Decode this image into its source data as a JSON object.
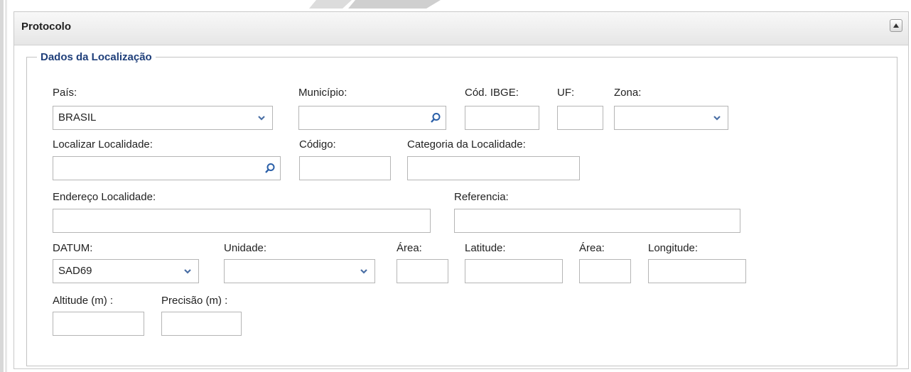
{
  "panel": {
    "title": "Protocolo"
  },
  "fieldset": {
    "legend": "Dados da Localização"
  },
  "labels": {
    "pais": "País:",
    "municipio": "Município:",
    "cod_ibge": "Cód. IBGE:",
    "uf": "UF:",
    "zona": "Zona:",
    "localizar": "Localizar Localidade:",
    "codigo": "Código:",
    "categoria": "Categoria da Localidade:",
    "endereco": "Endereço Localidade:",
    "referencia": "Referencia:",
    "datum": "DATUM:",
    "unidade": "Unidade:",
    "area1": "Área:",
    "latitude": "Latitude:",
    "area2": "Área:",
    "longitude": "Longitude:",
    "altitude": "Altitude (m) :",
    "precisao": "Precisão (m) :"
  },
  "values": {
    "pais": "BRASIL",
    "municipio": "",
    "cod_ibge": "",
    "uf": "",
    "zona": "",
    "localizar": "",
    "codigo": "",
    "categoria": "",
    "endereco": "",
    "referencia": "",
    "datum": "SAD69",
    "unidade": "",
    "area1": "",
    "latitude": "",
    "area2": "",
    "longitude": "",
    "altitude": "",
    "precisao": ""
  },
  "colors": {
    "legend": "#1f3f7a",
    "search_icon": "#2a5fa8",
    "chevron": "#4a6fa5"
  },
  "icons": {
    "collapse": "triangle-up-icon",
    "search": "magnifier-icon",
    "dropdown": "chevron-down-icon"
  }
}
